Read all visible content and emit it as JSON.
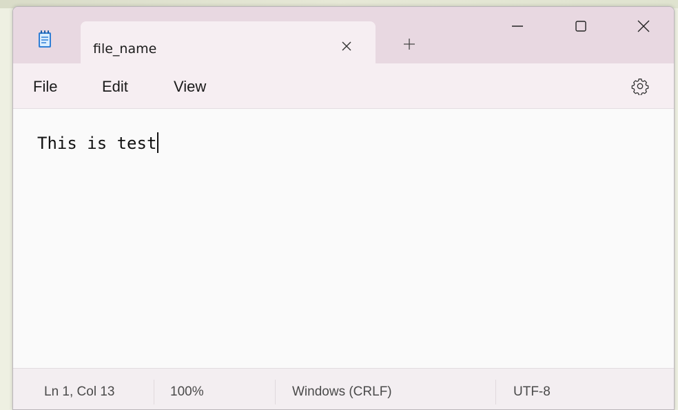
{
  "tab": {
    "title": "file_name"
  },
  "menu": {
    "file": "File",
    "edit": "Edit",
    "view": "View"
  },
  "editor": {
    "content": "This is test"
  },
  "status": {
    "position": "Ln 1, Col 13",
    "zoom": "100%",
    "line_ending": "Windows (CRLF)",
    "encoding": "UTF-8"
  },
  "icons": {
    "app": "notepad-icon",
    "tab_close": "close-icon",
    "new_tab": "plus-icon",
    "minimize": "minimize-icon",
    "maximize": "maximize-icon",
    "close": "close-icon",
    "settings": "gear-icon"
  },
  "colors": {
    "titlebar": "#e8d8e1",
    "active_tab": "#f6eef2",
    "editor_bg": "#fafafa",
    "statusbar": "#f3eef1"
  }
}
